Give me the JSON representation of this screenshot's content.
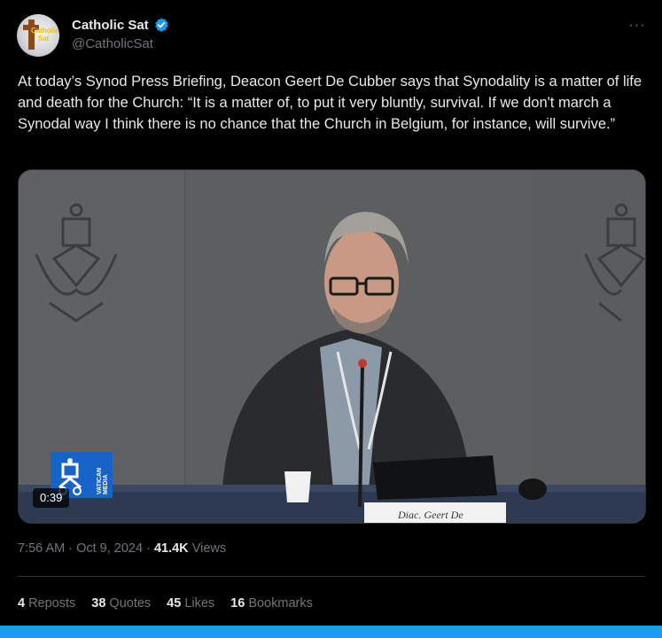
{
  "author": {
    "name": "Catholic Sat",
    "handle": "@CatholicSat",
    "avatar_text": "Catholic Sat",
    "verified": true,
    "verified_color": "#1d9bf0"
  },
  "more_icon": "more-dots-icon",
  "tweet": {
    "text": "At today’s Synod Press Briefing, Deacon Geert De Cubber says that Synodality is a matter of life and death for the Church: “It is a matter of, to put it very bluntly, survival. If we don't march a Synodal way I think there is no chance that the Church in Belgium, for instance, will survive.”"
  },
  "media": {
    "duration": "0:39",
    "logo_text": "VATICAN MEDIA",
    "nameplate_text": "Diac. Geert De"
  },
  "meta": {
    "time": "7:56 AM",
    "separator": " · ",
    "date": "Oct 9, 2024",
    "views_count": "41.4K",
    "views_label": "Views"
  },
  "stats": [
    {
      "count": "4",
      "label": "Reposts"
    },
    {
      "count": "38",
      "label": "Quotes"
    },
    {
      "count": "45",
      "label": "Likes"
    },
    {
      "count": "16",
      "label": "Bookmarks"
    }
  ],
  "colors": {
    "background": "#000000",
    "text": "#e7e9ea",
    "muted": "#71767b",
    "accent": "#1d9bf0"
  }
}
